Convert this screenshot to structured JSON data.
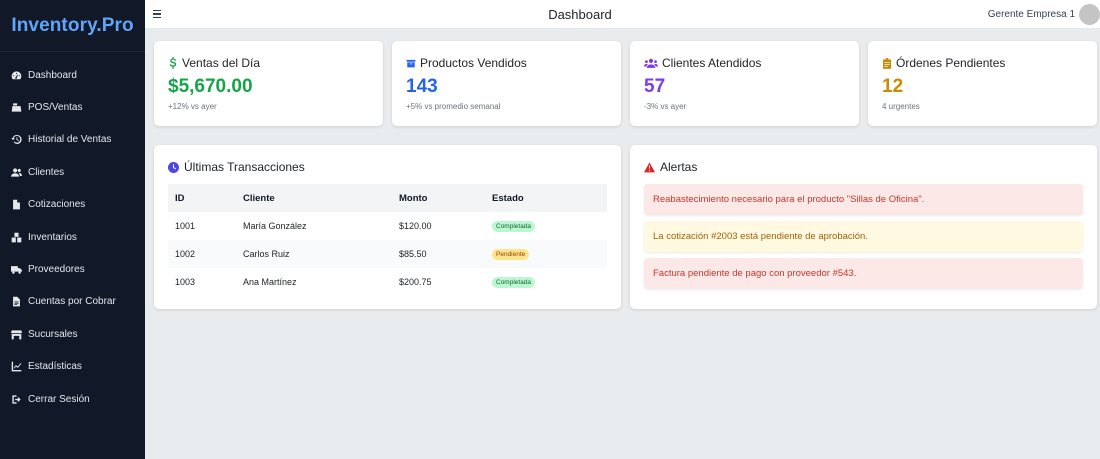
{
  "brand": "Inventory.Pro",
  "sidebar": {
    "items": [
      {
        "label": "Dashboard",
        "icon": "gauge-icon"
      },
      {
        "label": "POS/Ventas",
        "icon": "cash-register-icon"
      },
      {
        "label": "Historial de Ventas",
        "icon": "history-icon"
      },
      {
        "label": "Clientes",
        "icon": "users-icon"
      },
      {
        "label": "Cotizaciones",
        "icon": "file-icon"
      },
      {
        "label": "Inventarios",
        "icon": "boxes-icon"
      },
      {
        "label": "Proveedores",
        "icon": "truck-icon"
      },
      {
        "label": "Cuentas por Cobrar",
        "icon": "file-invoice-icon"
      },
      {
        "label": "Sucursales",
        "icon": "store-icon"
      },
      {
        "label": "Estadísticas",
        "icon": "chart-line-icon"
      },
      {
        "label": "Cerrar Sesión",
        "icon": "sign-out-icon"
      }
    ]
  },
  "topbar": {
    "title": "Dashboard",
    "user": "Gerente Empresa 1"
  },
  "stats": {
    "ventas": {
      "title": "Ventas del Día",
      "value": "$5,670.00",
      "sub": "+12% vs ayer",
      "color": "#16a34a"
    },
    "productos": {
      "title": "Productos Vendidos",
      "value": "143",
      "sub": "+5% vs promedio semanal",
      "color": "#2563eb"
    },
    "clientes": {
      "title": "Clientes Atendidos",
      "value": "57",
      "sub": "-3% vs ayer",
      "color": "#7c3aed"
    },
    "ordenes": {
      "title": "Órdenes Pendientes",
      "value": "12",
      "sub": "4 urgentes",
      "color": "#ca8a04"
    }
  },
  "transactions": {
    "title": "Últimas Transacciones",
    "headers": [
      "ID",
      "Cliente",
      "Monto",
      "Estado"
    ],
    "rows": [
      {
        "id": "1001",
        "cliente": "María González",
        "monto": "$120.00",
        "estado": "Completada"
      },
      {
        "id": "1002",
        "cliente": "Carlos Ruiz",
        "monto": "$85.50",
        "estado": "Pendiente"
      },
      {
        "id": "1003",
        "cliente": "Ana Martínez",
        "monto": "$200.75",
        "estado": "Completada"
      }
    ]
  },
  "alerts": {
    "title": "Alertas",
    "items": [
      "Reabastecimiento necesario para el producto \"Sillas de Oficina\".",
      "La cotización #2003 está pendiente de aprobación.",
      "Factura pendiente de pago con proveedor #543."
    ]
  }
}
